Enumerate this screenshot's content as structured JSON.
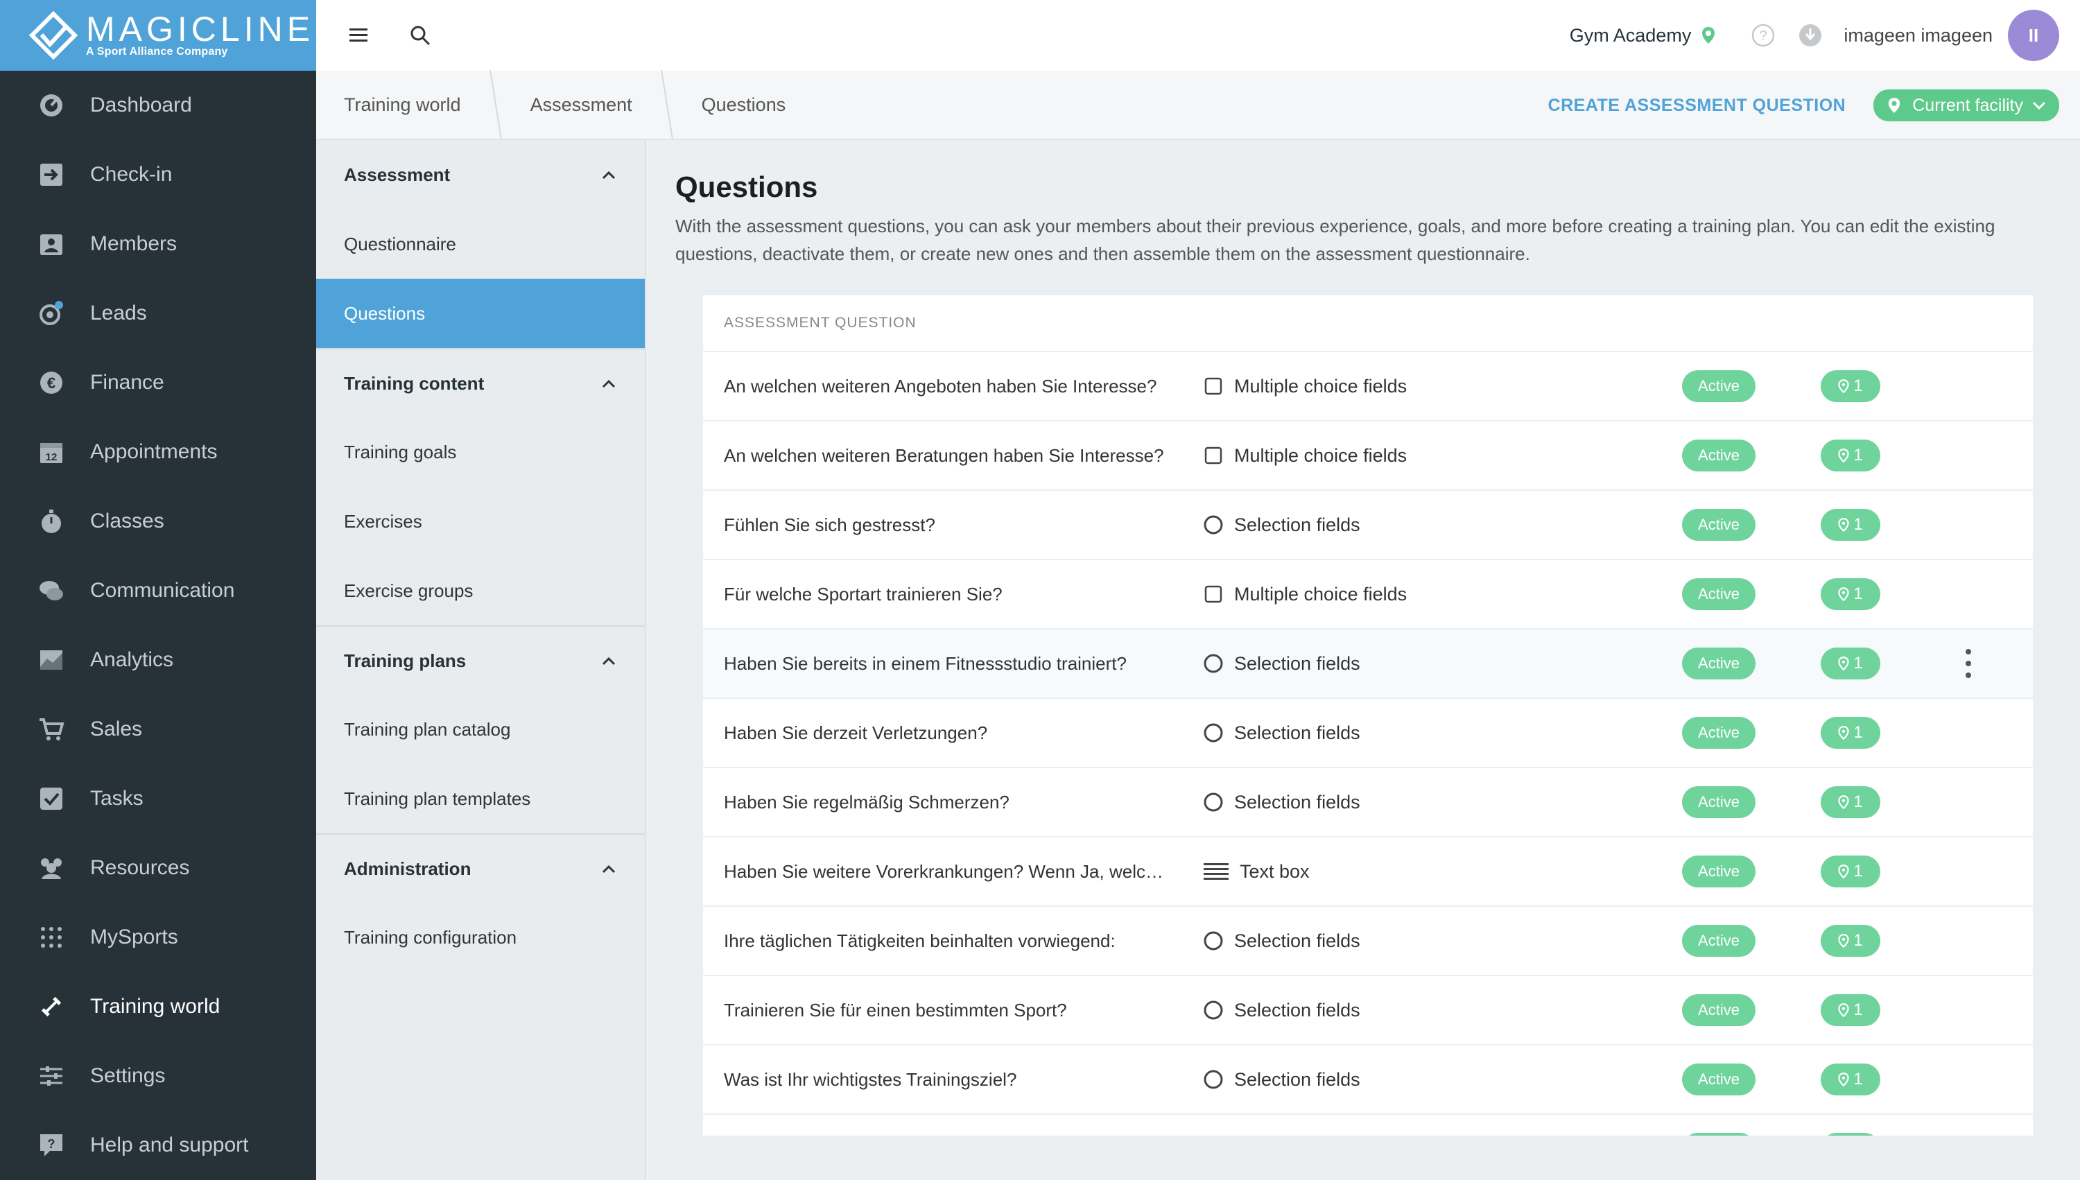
{
  "brand": {
    "name": "MAGICLINE",
    "tagline": "A Sport Alliance Company"
  },
  "nav": [
    {
      "label": "Dashboard",
      "icon": "dashboard-icon"
    },
    {
      "label": "Check-in",
      "icon": "check-in-icon"
    },
    {
      "label": "Members",
      "icon": "members-icon"
    },
    {
      "label": "Leads",
      "icon": "leads-icon"
    },
    {
      "label": "Finance",
      "icon": "euro-icon"
    },
    {
      "label": "Appointments",
      "icon": "calendar-icon"
    },
    {
      "label": "Classes",
      "icon": "stopwatch-icon"
    },
    {
      "label": "Communication",
      "icon": "chat-icon"
    },
    {
      "label": "Analytics",
      "icon": "chart-icon"
    },
    {
      "label": "Sales",
      "icon": "cart-icon"
    },
    {
      "label": "Tasks",
      "icon": "checkbox-icon"
    },
    {
      "label": "Resources",
      "icon": "resources-icon"
    },
    {
      "label": "MySports",
      "icon": "mysports-icon"
    },
    {
      "label": "Training world",
      "icon": "dumbbell-icon"
    },
    {
      "label": "Settings",
      "icon": "sliders-icon"
    },
    {
      "label": "Help and support",
      "icon": "help-icon"
    }
  ],
  "nav_active_index": 13,
  "topbar": {
    "gym": "Gym Academy",
    "user": "imageen imageen",
    "avatar_initials": "II"
  },
  "breadcrumb": [
    "Training world",
    "Assessment",
    "Questions"
  ],
  "actions": {
    "create": "CREATE ASSESSMENT QUESTION",
    "facility": "Current facility"
  },
  "subnav": {
    "sections": [
      {
        "title": "Assessment",
        "items": [
          "Questionnaire",
          "Questions"
        ]
      },
      {
        "title": "Training content",
        "items": [
          "Training goals",
          "Exercises",
          "Exercise groups"
        ]
      },
      {
        "title": "Training plans",
        "items": [
          "Training plan catalog",
          "Training plan templates"
        ]
      },
      {
        "title": "Administration",
        "items": [
          "Training configuration"
        ]
      }
    ],
    "active_item": "Questions"
  },
  "page": {
    "title": "Questions",
    "description": "With the assessment questions, you can ask your members about their previous experience, goals, and more before creating a training plan. You can edit the existing questions, deactivate them, or create new ones and then assemble them on the assessment questionnaire."
  },
  "table": {
    "header": "ASSESSMENT QUESTION",
    "rows": [
      {
        "question": "An welchen weiteren Angeboten haben Sie Interesse?",
        "type": "Multiple choice fields",
        "type_icon": "checkbox",
        "status": "Active",
        "locations": "1"
      },
      {
        "question": "An welchen weiteren Beratungen haben Sie Interesse?",
        "type": "Multiple choice fields",
        "type_icon": "checkbox",
        "status": "Active",
        "locations": "1"
      },
      {
        "question": "Fühlen Sie sich gestresst?",
        "type": "Selection fields",
        "type_icon": "radio",
        "status": "Active",
        "locations": "1"
      },
      {
        "question": "Für welche Sportart trainieren Sie?",
        "type": "Multiple choice fields",
        "type_icon": "checkbox",
        "status": "Active",
        "locations": "1"
      },
      {
        "question": "Haben Sie bereits in einem Fitnessstudio trainiert?",
        "type": "Selection fields",
        "type_icon": "radio",
        "status": "Active",
        "locations": "1"
      },
      {
        "question": "Haben Sie derzeit Verletzungen?",
        "type": "Selection fields",
        "type_icon": "radio",
        "status": "Active",
        "locations": "1"
      },
      {
        "question": "Haben Sie regelmäßig Schmerzen?",
        "type": "Selection fields",
        "type_icon": "radio",
        "status": "Active",
        "locations": "1"
      },
      {
        "question": "Haben Sie weitere Vorerkrankungen? Wenn Ja, welc…",
        "type": "Text box",
        "type_icon": "textbox",
        "status": "Active",
        "locations": "1"
      },
      {
        "question": "Ihre täglichen Tätigkeiten beinhalten vorwiegend:",
        "type": "Selection fields",
        "type_icon": "radio",
        "status": "Active",
        "locations": "1"
      },
      {
        "question": "Trainieren Sie für einen bestimmten Sport?",
        "type": "Selection fields",
        "type_icon": "radio",
        "status": "Active",
        "locations": "1"
      },
      {
        "question": "Was ist Ihr wichtigstes Trainingsziel?",
        "type": "Selection fields",
        "type_icon": "radio",
        "status": "Active",
        "locations": "1"
      }
    ],
    "hover_row_index": 4
  },
  "colors": {
    "primary": "#4fa3d9",
    "sidebar": "#263238",
    "success": "#6fd39c",
    "avatar": "#9b8bd6"
  }
}
